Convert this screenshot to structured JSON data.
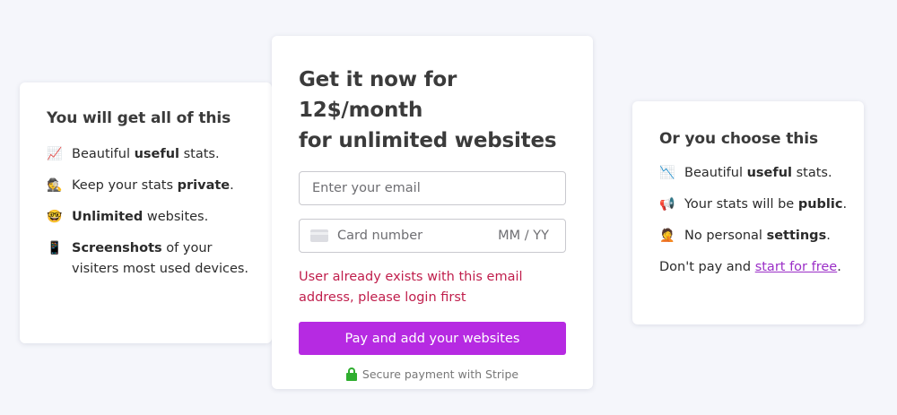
{
  "left": {
    "title": "You will get all of this",
    "features": [
      {
        "emoji": "📈",
        "pre": "Beautiful ",
        "bold": "useful",
        "post": " stats."
      },
      {
        "emoji": "🕵️",
        "pre": "Keep your stats ",
        "bold": "private",
        "post": "."
      },
      {
        "emoji": "🤓",
        "pre": "",
        "bold": "Unlimited",
        "post": " websites."
      },
      {
        "emoji": "📱",
        "pre": "",
        "bold": "Screenshots",
        "post": " of your visiters most used devices."
      }
    ]
  },
  "main": {
    "title_line1": "Get it now for 12$/month",
    "title_line2": "for unlimited websites",
    "email_placeholder": "Enter your email",
    "card_placeholder": "Card number",
    "expiry_placeholder": "MM / YY",
    "error": "User already exists with this email address, please login first",
    "pay_label": "Pay and add your websites",
    "secure_label": "Secure payment with Stripe",
    "colors": {
      "pay_button": "#b62ae2",
      "error": "#c01e4c",
      "lock": "#2fae2f"
    }
  },
  "right": {
    "title": "Or you choose this",
    "features": [
      {
        "emoji": "📉",
        "pre": "Beautiful ",
        "bold": "useful",
        "post": " stats."
      },
      {
        "emoji": "📢",
        "pre": "Your stats will be ",
        "bold": "public",
        "post": "."
      },
      {
        "emoji": "🤦",
        "pre": "No personal ",
        "bold": "settings",
        "post": "."
      }
    ],
    "note_pre": "Don't pay and ",
    "note_link": "start for free",
    "note_post": "."
  }
}
